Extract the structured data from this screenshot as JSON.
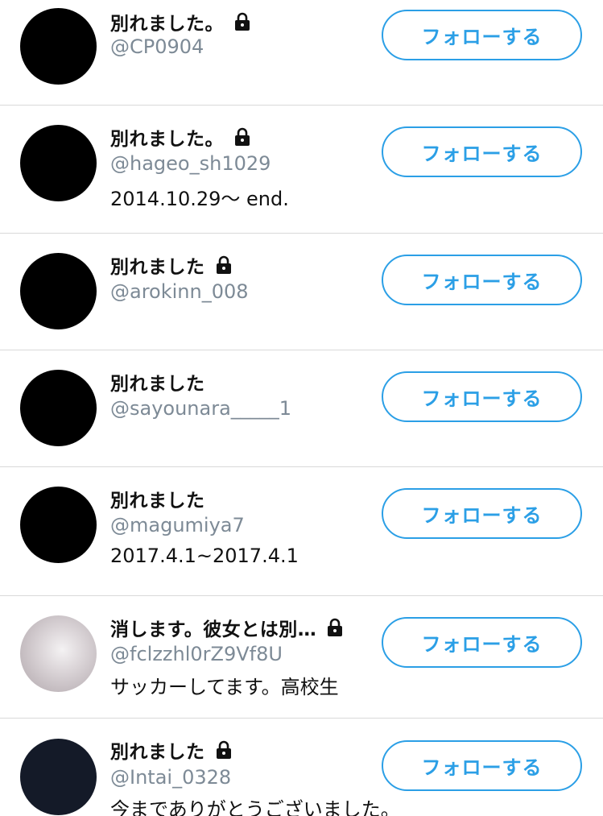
{
  "follow_label": "フォローする",
  "accent_color": "#2b9fe6",
  "users": [
    {
      "name": "別れました。",
      "handle": "@CP0904",
      "bio": "",
      "locked": true,
      "avatar": "black"
    },
    {
      "name": "別れました。",
      "handle": "@hageo_sh1029",
      "bio": "2014.10.29〜 end.",
      "locked": true,
      "avatar": "black"
    },
    {
      "name": "別れました",
      "handle": "@arokinn_008",
      "bio": "",
      "locked": true,
      "avatar": "black"
    },
    {
      "name": "別れました",
      "handle": "@sayounara_____1",
      "bio": "",
      "locked": false,
      "avatar": "black"
    },
    {
      "name": "別れました",
      "handle": "@magumiya7",
      "bio": "2017.4.1~2017.4.1",
      "locked": false,
      "avatar": "black"
    },
    {
      "name": "消します。彼女とは別…",
      "handle": "@fclzzhl0rZ9Vf8U",
      "bio": "サッカーしてます。高校生",
      "locked": true,
      "avatar": "photo"
    },
    {
      "name": "別れました",
      "handle": "@Intai_0328",
      "bio": "今までありがとうございました。",
      "locked": true,
      "avatar": "navy"
    }
  ]
}
